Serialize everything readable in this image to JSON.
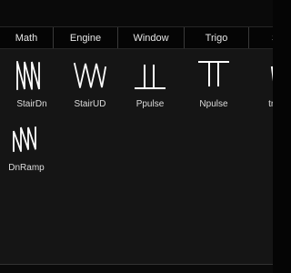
{
  "tabs": [
    {
      "label": "Math"
    },
    {
      "label": "Engine"
    },
    {
      "label": "Window"
    },
    {
      "label": "Trigo"
    },
    {
      "label": "S"
    }
  ],
  "items": [
    {
      "label": "StairDn",
      "icon": "stair-down-icon"
    },
    {
      "label": "StairUD",
      "icon": "stair-up-down-icon"
    },
    {
      "label": "Ppulse",
      "icon": "positive-pulse-icon"
    },
    {
      "label": "Npulse",
      "icon": "negative-pulse-icon"
    },
    {
      "label": "tra",
      "icon": "triangle-wave-icon"
    },
    {
      "label": "DnRamp",
      "icon": "down-ramp-icon"
    }
  ],
  "colors": {
    "background": "#151515",
    "icon": "#ffffff",
    "text": "#dcdcdc"
  }
}
